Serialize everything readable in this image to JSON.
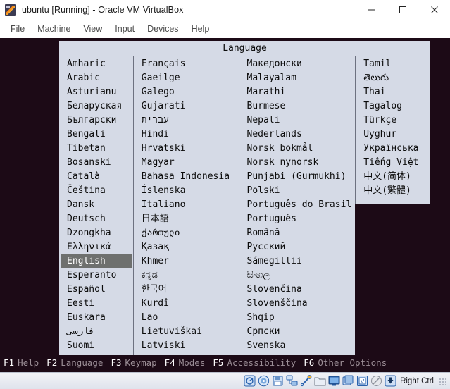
{
  "window": {
    "title": "ubuntu [Running] - Oracle VM VirtualBox",
    "app_icon": "virtualbox-icon",
    "controls": {
      "minimize": "minimize-button",
      "maximize": "maximize-button",
      "close": "close-button"
    }
  },
  "menubar": {
    "items": [
      {
        "label": "File"
      },
      {
        "label": "Machine"
      },
      {
        "label": "View"
      },
      {
        "label": "Input"
      },
      {
        "label": "Devices"
      },
      {
        "label": "Help"
      }
    ]
  },
  "dialog": {
    "title": "Language",
    "selected": "English",
    "columns": [
      {
        "id": "col-1",
        "items": [
          "Amharic",
          "Arabic",
          "Asturianu",
          "Беларуская",
          "Български",
          "Bengali",
          "Tibetan",
          "Bosanski",
          "Català",
          "Čeština",
          "Dansk",
          "Deutsch",
          "Dzongkha",
          "Ελληνικά",
          "English",
          "Esperanto",
          "Español",
          "Eesti",
          "Euskara",
          "فارسی",
          "Suomi"
        ]
      },
      {
        "id": "col-2",
        "items": [
          "Français",
          "Gaeilge",
          "Galego",
          "Gujarati",
          "עברית",
          "Hindi",
          "Hrvatski",
          "Magyar",
          "Bahasa Indonesia",
          "Íslenska",
          "Italiano",
          "日本語",
          "ქართული",
          "Қазақ",
          "Khmer",
          "ಕನ್ನಡ",
          "한국어",
          "Kurdî",
          "Lao",
          "Lietuviškai",
          "Latviski"
        ]
      },
      {
        "id": "col-3",
        "items": [
          "Македонски",
          "Malayalam",
          "Marathi",
          "Burmese",
          "Nepali",
          "Nederlands",
          "Norsk bokmål",
          "Norsk nynorsk",
          "Punjabi (Gurmukhi)",
          "Polski",
          "Português do Brasil",
          "Português",
          "Română",
          "Русский",
          "Sámegillii",
          "සිංහල",
          "Slovenčina",
          "Slovenščina",
          "Shqip",
          "Српски",
          "Svenska"
        ]
      },
      {
        "id": "col-4",
        "items": [
          "Tamil",
          "తెలుగు",
          "Thai",
          "Tagalog",
          "Türkçe",
          "Uyghur",
          "Українська",
          "Tiếng Việt",
          "中文(简体)",
          "中文(繁體)"
        ]
      }
    ]
  },
  "function_keys": [
    {
      "key": "F1",
      "desc": "Help"
    },
    {
      "key": "F2",
      "desc": "Language"
    },
    {
      "key": "F3",
      "desc": "Keymap"
    },
    {
      "key": "F4",
      "desc": "Modes"
    },
    {
      "key": "F5",
      "desc": "Accessibility"
    },
    {
      "key": "F6",
      "desc": "Other Options"
    }
  ],
  "statusbar": {
    "icons": [
      "hard-disk-icon",
      "optical-disk-icon",
      "floppy-disk-icon",
      "network-icon",
      "usb-icon",
      "shared-folder-icon",
      "display-icon",
      "video-capture-icon",
      "virtualization-icon",
      "mouse-icon",
      "keyboard-icon"
    ],
    "host_key": "Right Ctrl"
  },
  "colors": {
    "guest_background": "#1c0a16",
    "dialog_background": "#d5dae6",
    "selection_background": "#6e706e",
    "fkey_label": "#ffffff",
    "fkey_desc": "#9b8e96"
  }
}
